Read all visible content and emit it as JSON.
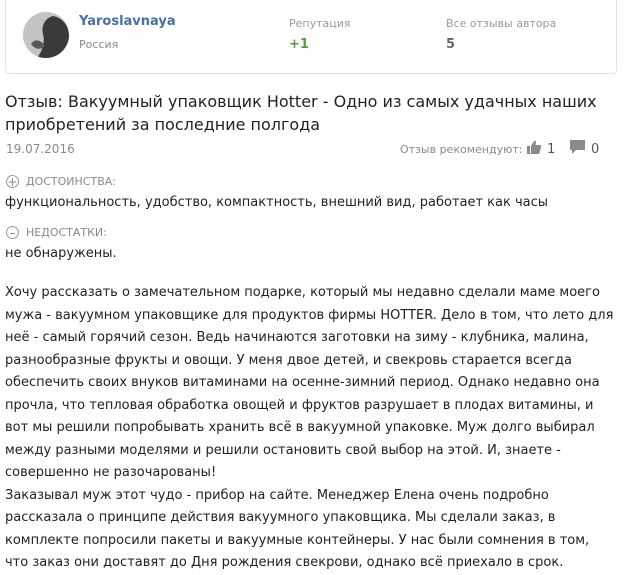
{
  "author": {
    "name": "Yaroslavnaya",
    "country": "Россия",
    "reputation_label": "Репутация",
    "reputation_value": "+1",
    "reviews_label": "Все отзывы автора",
    "reviews_value": "5"
  },
  "review": {
    "title": "Отзыв: Вакуумный упаковщик Hotter - Одно из самых удачных наших приобретений за последние полгода",
    "date": "19.07.2016",
    "recommend_label": "Отзыв рекомендуют:",
    "likes": "1",
    "comments": "0",
    "pros_label": "ДОСТОИНСТВА:",
    "pros": "функциональность, удобство, компактность, внешний вид, работает как часы",
    "cons_label": "НЕДОСТАТКИ:",
    "cons": "не обнаружены.",
    "paragraphs": [
      "Хочу рассказать о замечательном подарке, который мы недавно сделали маме моего мужа - вакуумном упаковщике для продуктов фирмы HOTTER. Дело в том, что лето для неё - самый горячий сезон. Ведь начинаются заготовки на зиму - клубника, малина, разнообразные фрукты и овощи. У меня двое детей, и свекровь старается всегда обеспечить своих внуков витаминами на осенне-зимний период. Однако недавно она прочла, что тепловая обработка овощей и фруктов разрушает в плодах витамины, и вот мы решили попробывать хранить всё в вакуумной упаковке. Муж долго выбирал между разными моделями и решили остановить свой выбор на этой. И, знаете - совершенно не разочарованы!",
      "Заказывал муж этот чудо - прибор на сайте. Менеджер Елена очень подробно рассказала о принципе действия вакуумного упаковщика. Мы сделали заказ, в комплекте попросили пакеты и вакуумные контейнеры. У нас были сомнения в том, что заказ они доставят до Дня рождения свекрови, однако всё приехало в срок."
    ]
  },
  "icons": {
    "like": "thumbs-up-icon",
    "comment": "comment-icon",
    "pros": "plus-circle-icon",
    "cons": "minus-circle-icon"
  },
  "colors": {
    "author_link": "#4a6fa5",
    "reputation_positive": "#5a9a3c",
    "muted_text": "#8a8a8a"
  }
}
